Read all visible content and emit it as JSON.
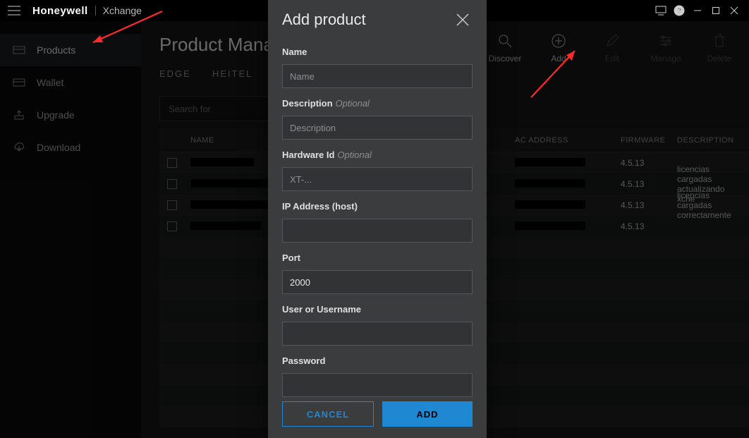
{
  "titlebar": {
    "brand": "Honeywell",
    "app": "Xchange"
  },
  "sidebar": {
    "items": [
      {
        "label": "Products"
      },
      {
        "label": "Wallet"
      },
      {
        "label": "Upgrade"
      },
      {
        "label": "Download"
      }
    ]
  },
  "page": {
    "title": "Product Mana",
    "tabs": [
      {
        "label": "EDGE"
      },
      {
        "label": "HEITEL"
      }
    ],
    "search_placeholder": "Search for"
  },
  "toolbar": {
    "discover": "Discover",
    "add": "Add",
    "edit": "Edit",
    "manage": "Manage",
    "delete": "Delete"
  },
  "table": {
    "columns": {
      "name": "NAME",
      "mac": "AC ADDRESS",
      "firmware": "FIRMWARE",
      "description": "DESCRIPTION"
    },
    "rows": [
      {
        "firmware": "4.5.13",
        "description": ""
      },
      {
        "firmware": "4.5.13",
        "description": "licencias cargadas actualizando xche"
      },
      {
        "firmware": "4.5.13",
        "description": "licencias cargadas correctamente"
      },
      {
        "firmware": "4.5.13",
        "description": ""
      }
    ]
  },
  "modal": {
    "title": "Add product",
    "fields": {
      "name_label": "Name",
      "name_placeholder": "Name",
      "description_label": "Description",
      "description_optional": "Optional",
      "description_placeholder": "Description",
      "hardware_label": "Hardware Id",
      "hardware_optional": "Optional",
      "hardware_placeholder": "XT-...",
      "ip_label": "IP Address (host)",
      "port_label": "Port",
      "port_value": "2000",
      "user_label": "User or Username",
      "password_label": "Password"
    },
    "actions": {
      "cancel": "CANCEL",
      "add": "ADD"
    }
  }
}
